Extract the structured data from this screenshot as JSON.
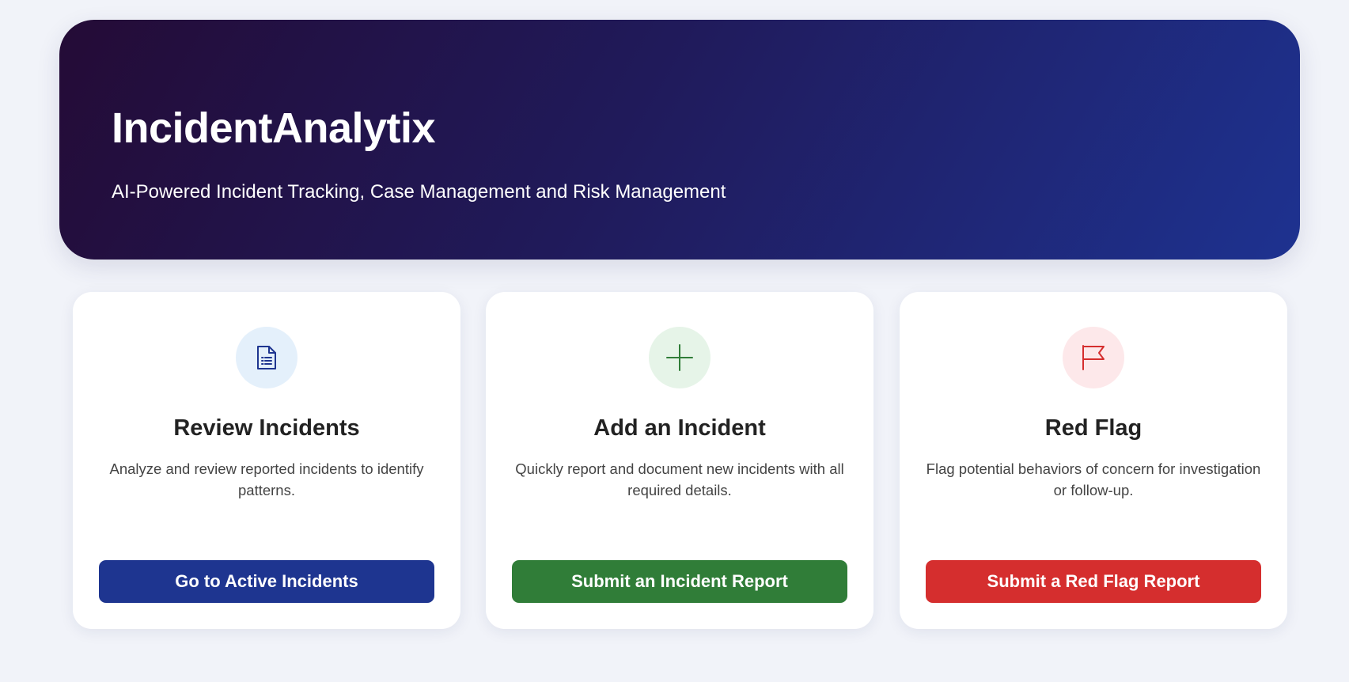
{
  "header": {
    "title": "IncidentAnalytix",
    "subtitle": "AI-Powered Incident Tracking, Case Management and Risk Management"
  },
  "cards": [
    {
      "icon": "document-list-icon",
      "icon_color": "#1e3590",
      "title": "Review Incidents",
      "description": "Analyze and review reported incidents to identify patterns.",
      "button_label": "Go to Active Incidents",
      "button_color": "#1e3590"
    },
    {
      "icon": "plus-icon",
      "icon_color": "#307d38",
      "title": "Add an Incident",
      "description": "Quickly report and document new incidents with all required details.",
      "button_label": "Submit an Incident Report",
      "button_color": "#307d38"
    },
    {
      "icon": "flag-icon",
      "icon_color": "#d52e2e",
      "title": "Red Flag",
      "description": "Flag potential behaviors of concern for investigation or follow-up.",
      "button_label": "Submit a Red Flag Report",
      "button_color": "#d52e2e"
    }
  ]
}
